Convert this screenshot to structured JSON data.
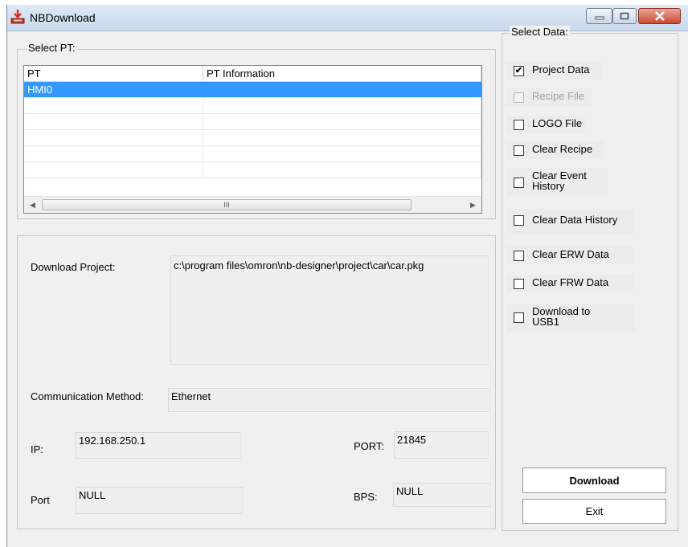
{
  "window": {
    "title": "NBDownload"
  },
  "select_pt": {
    "label": "Select PT:",
    "columns": [
      "PT",
      "PT Information"
    ],
    "rows": [
      {
        "pt": "HMI0",
        "info": "",
        "selected": true
      },
      {
        "pt": "",
        "info": ""
      },
      {
        "pt": "",
        "info": ""
      },
      {
        "pt": "",
        "info": ""
      },
      {
        "pt": "",
        "info": ""
      },
      {
        "pt": "",
        "info": ""
      }
    ],
    "scroll_thumb_glyph": "III"
  },
  "details": {
    "download_project_label": "Download Project:",
    "download_project_value": "c:\\program files\\omron\\nb-designer\\project\\car\\car.pkg",
    "comm_method_label": "Communication Method:",
    "comm_method_value": "Ethernet",
    "ip_label": "IP:",
    "ip_value": "192.168.250.1",
    "port_upper_label": "PORT:",
    "port_upper_value": "21845",
    "port_lower_label": "Port",
    "port_lower_value": "NULL",
    "bps_label": "BPS:",
    "bps_value": "NULL"
  },
  "select_data": {
    "label": "Select Data:",
    "items": [
      {
        "label": "Project Data",
        "checked": true,
        "enabled": true
      },
      {
        "label": "Recipe File",
        "checked": false,
        "enabled": false
      },
      {
        "label": "LOGO File",
        "checked": false,
        "enabled": true
      },
      {
        "label": "Clear Recipe",
        "checked": false,
        "enabled": true
      },
      {
        "label": "Clear Event\nHistory",
        "checked": false,
        "enabled": true
      },
      {
        "label": "Clear Data History",
        "checked": false,
        "enabled": true
      },
      {
        "label": "Clear ERW Data",
        "checked": false,
        "enabled": true
      },
      {
        "label": "Clear FRW Data",
        "checked": false,
        "enabled": true
      },
      {
        "label": "Download to\nUSB1",
        "checked": false,
        "enabled": true
      }
    ]
  },
  "buttons": {
    "download": "Download",
    "exit": "Exit"
  },
  "icons": {
    "app": "download-tray-icon",
    "minimize": "minimize-icon",
    "maximize": "maximize-icon",
    "close": "close-icon",
    "checkmark": "✔",
    "scroll_left": "◀",
    "scroll_right": "▶"
  },
  "colors": {
    "selection": "#3399ff",
    "close_button": "#c84b33"
  }
}
